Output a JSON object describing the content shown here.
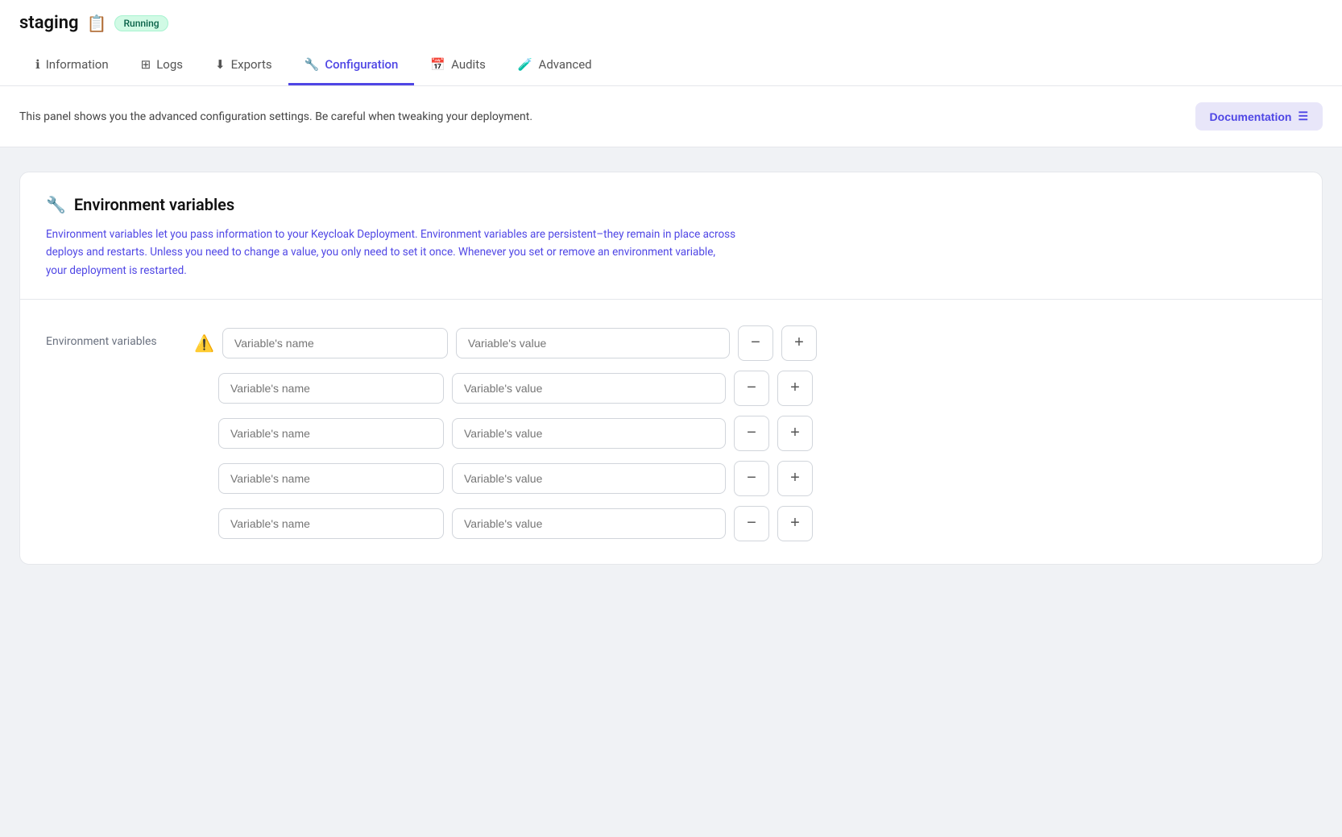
{
  "header": {
    "app_name": "staging",
    "status": "Running",
    "status_color": "#d1fae5",
    "status_text_color": "#065f46"
  },
  "nav": {
    "tabs": [
      {
        "id": "information",
        "label": "Information",
        "icon": "ℹ",
        "active": false
      },
      {
        "id": "logs",
        "label": "Logs",
        "icon": "📋",
        "active": false
      },
      {
        "id": "exports",
        "label": "Exports",
        "icon": "⬇",
        "active": false
      },
      {
        "id": "configuration",
        "label": "Configuration",
        "icon": "🔧",
        "active": true
      },
      {
        "id": "audits",
        "label": "Audits",
        "icon": "📅",
        "active": false
      },
      {
        "id": "advanced",
        "label": "Advanced",
        "icon": "🧪",
        "active": false
      }
    ]
  },
  "description": {
    "text": "This panel shows you the advanced configuration settings. Be careful when tweaking your deployment.",
    "doc_button_label": "Documentation"
  },
  "env_section": {
    "title": "Environment variables",
    "description": "Environment variables let you pass information to your Keycloak Deployment. Environment variables are persistent–they remain in place across deploys and restarts. Unless you need to change a value, you only need to set it once. Whenever you set or remove an environment variable, your deployment is restarted.",
    "label": "Environment variables",
    "rows": [
      {
        "has_warning": true,
        "name_placeholder": "Variable's name",
        "value_placeholder": "Variable's value"
      },
      {
        "has_warning": false,
        "name_placeholder": "Variable's name",
        "value_placeholder": "Variable's value"
      },
      {
        "has_warning": false,
        "name_placeholder": "Variable's name",
        "value_placeholder": "Variable's value"
      },
      {
        "has_warning": false,
        "name_placeholder": "Variable's name",
        "value_placeholder": "Variable's value"
      },
      {
        "has_warning": false,
        "name_placeholder": "Variable's name",
        "value_placeholder": "Variable's value"
      }
    ],
    "minus_label": "−",
    "plus_label": "+"
  }
}
